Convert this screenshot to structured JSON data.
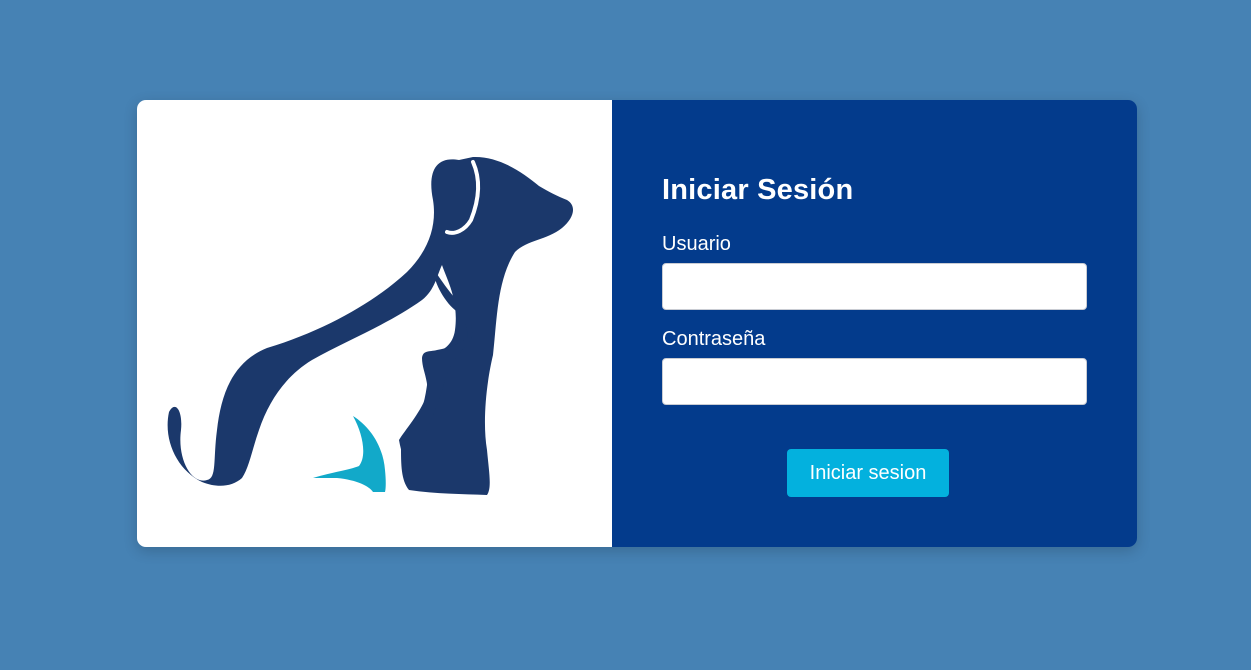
{
  "login": {
    "title": "Iniciar Sesión",
    "username_label": "Usuario",
    "username_value": "",
    "password_label": "Contraseña",
    "password_value": "",
    "submit_label": "Iniciar sesion"
  },
  "colors": {
    "background": "#4682B4",
    "panel": "#033B8C",
    "button": "#03B1DE",
    "logo_dark": "#1B386B",
    "logo_accent": "#12A9C9"
  },
  "icons": {
    "logo": "dog-cat-silhouette-logo"
  }
}
